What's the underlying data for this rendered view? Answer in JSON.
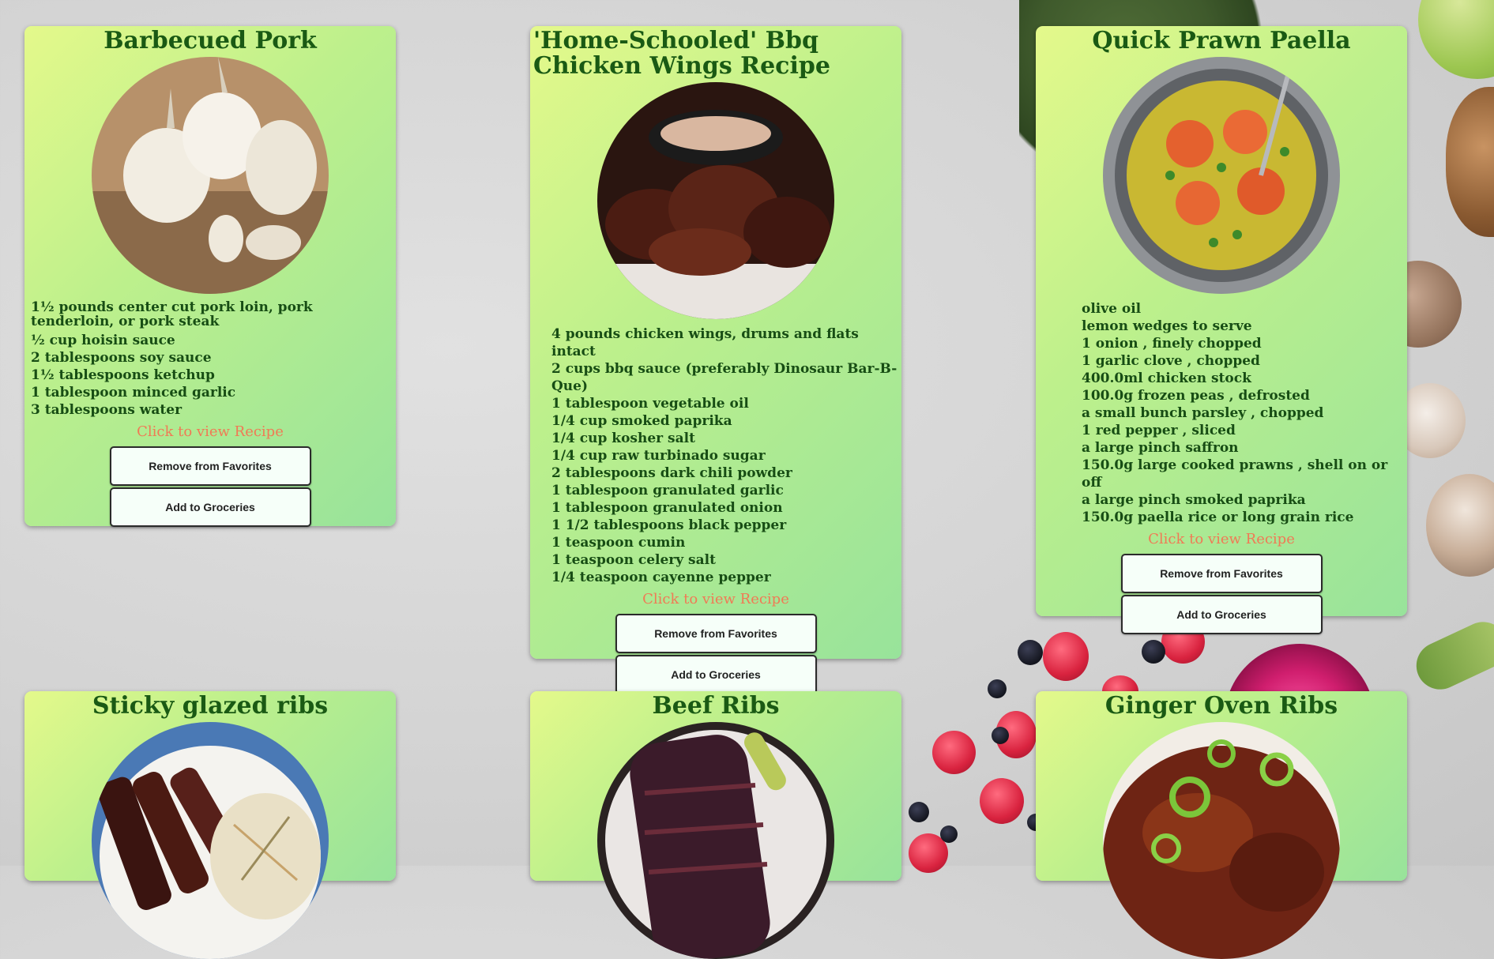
{
  "recipes": [
    {
      "title": "Barbecued Pork",
      "image_icon": "garlic-photo",
      "ingredients": [
        "1½ pounds center cut pork loin, pork tenderloin, or pork steak",
        "½ cup hoisin sauce",
        "2 tablespoons soy sauce",
        "1½ tablespoons ketchup",
        "1 tablespoon minced garlic",
        "3 tablespoons water"
      ],
      "view_label": "Click to view Recipe",
      "remove_label": "Remove from Favorites",
      "grocery_label": "Add to Groceries"
    },
    {
      "title": "'Home-Schooled' Bbq Chicken Wings Recipe",
      "image_icon": "bbq-wings-photo",
      "ingredients": [
        "4 pounds chicken wings, drums and flats intact",
        "2 cups bbq sauce (preferably Dinosaur Bar-B-Que)",
        "1 tablespoon vegetable oil",
        "1/4 cup smoked paprika",
        "1/4 cup kosher salt",
        "1/4 cup raw turbinado sugar",
        "2 tablespoons dark chili powder",
        "1 tablespoon granulated garlic",
        "1 tablespoon granulated onion",
        "1 1/2 tablespoons black pepper",
        "1 teaspoon cumin",
        "1 teaspoon celery salt",
        "1/4 teaspoon cayenne pepper"
      ],
      "view_label": "Click to view Recipe",
      "remove_label": "Remove from Favorites",
      "grocery_label": "Add to Groceries"
    },
    {
      "title": "Quick Prawn Paella",
      "image_icon": "paella-photo",
      "ingredients": [
        "olive oil",
        "lemon wedges to serve",
        "1 onion , finely chopped",
        "1 garlic clove , chopped",
        "400.0ml chicken stock",
        "100.0g frozen peas , defrosted",
        "a small bunch parsley , chopped",
        "1 red pepper , sliced",
        "a large pinch saffron",
        "150.0g large cooked prawns , shell on or off",
        "a large pinch smoked paprika",
        "150.0g paella rice or long grain rice"
      ],
      "view_label": "Click to view Recipe",
      "remove_label": "Remove from Favorites",
      "grocery_label": "Add to Groceries"
    },
    {
      "title": "Sticky glazed ribs",
      "image_icon": "glazed-ribs-photo"
    },
    {
      "title": "Beef Ribs",
      "image_icon": "beef-ribs-photo"
    },
    {
      "title": "Ginger Oven Ribs",
      "image_icon": "ginger-ribs-photo"
    }
  ]
}
